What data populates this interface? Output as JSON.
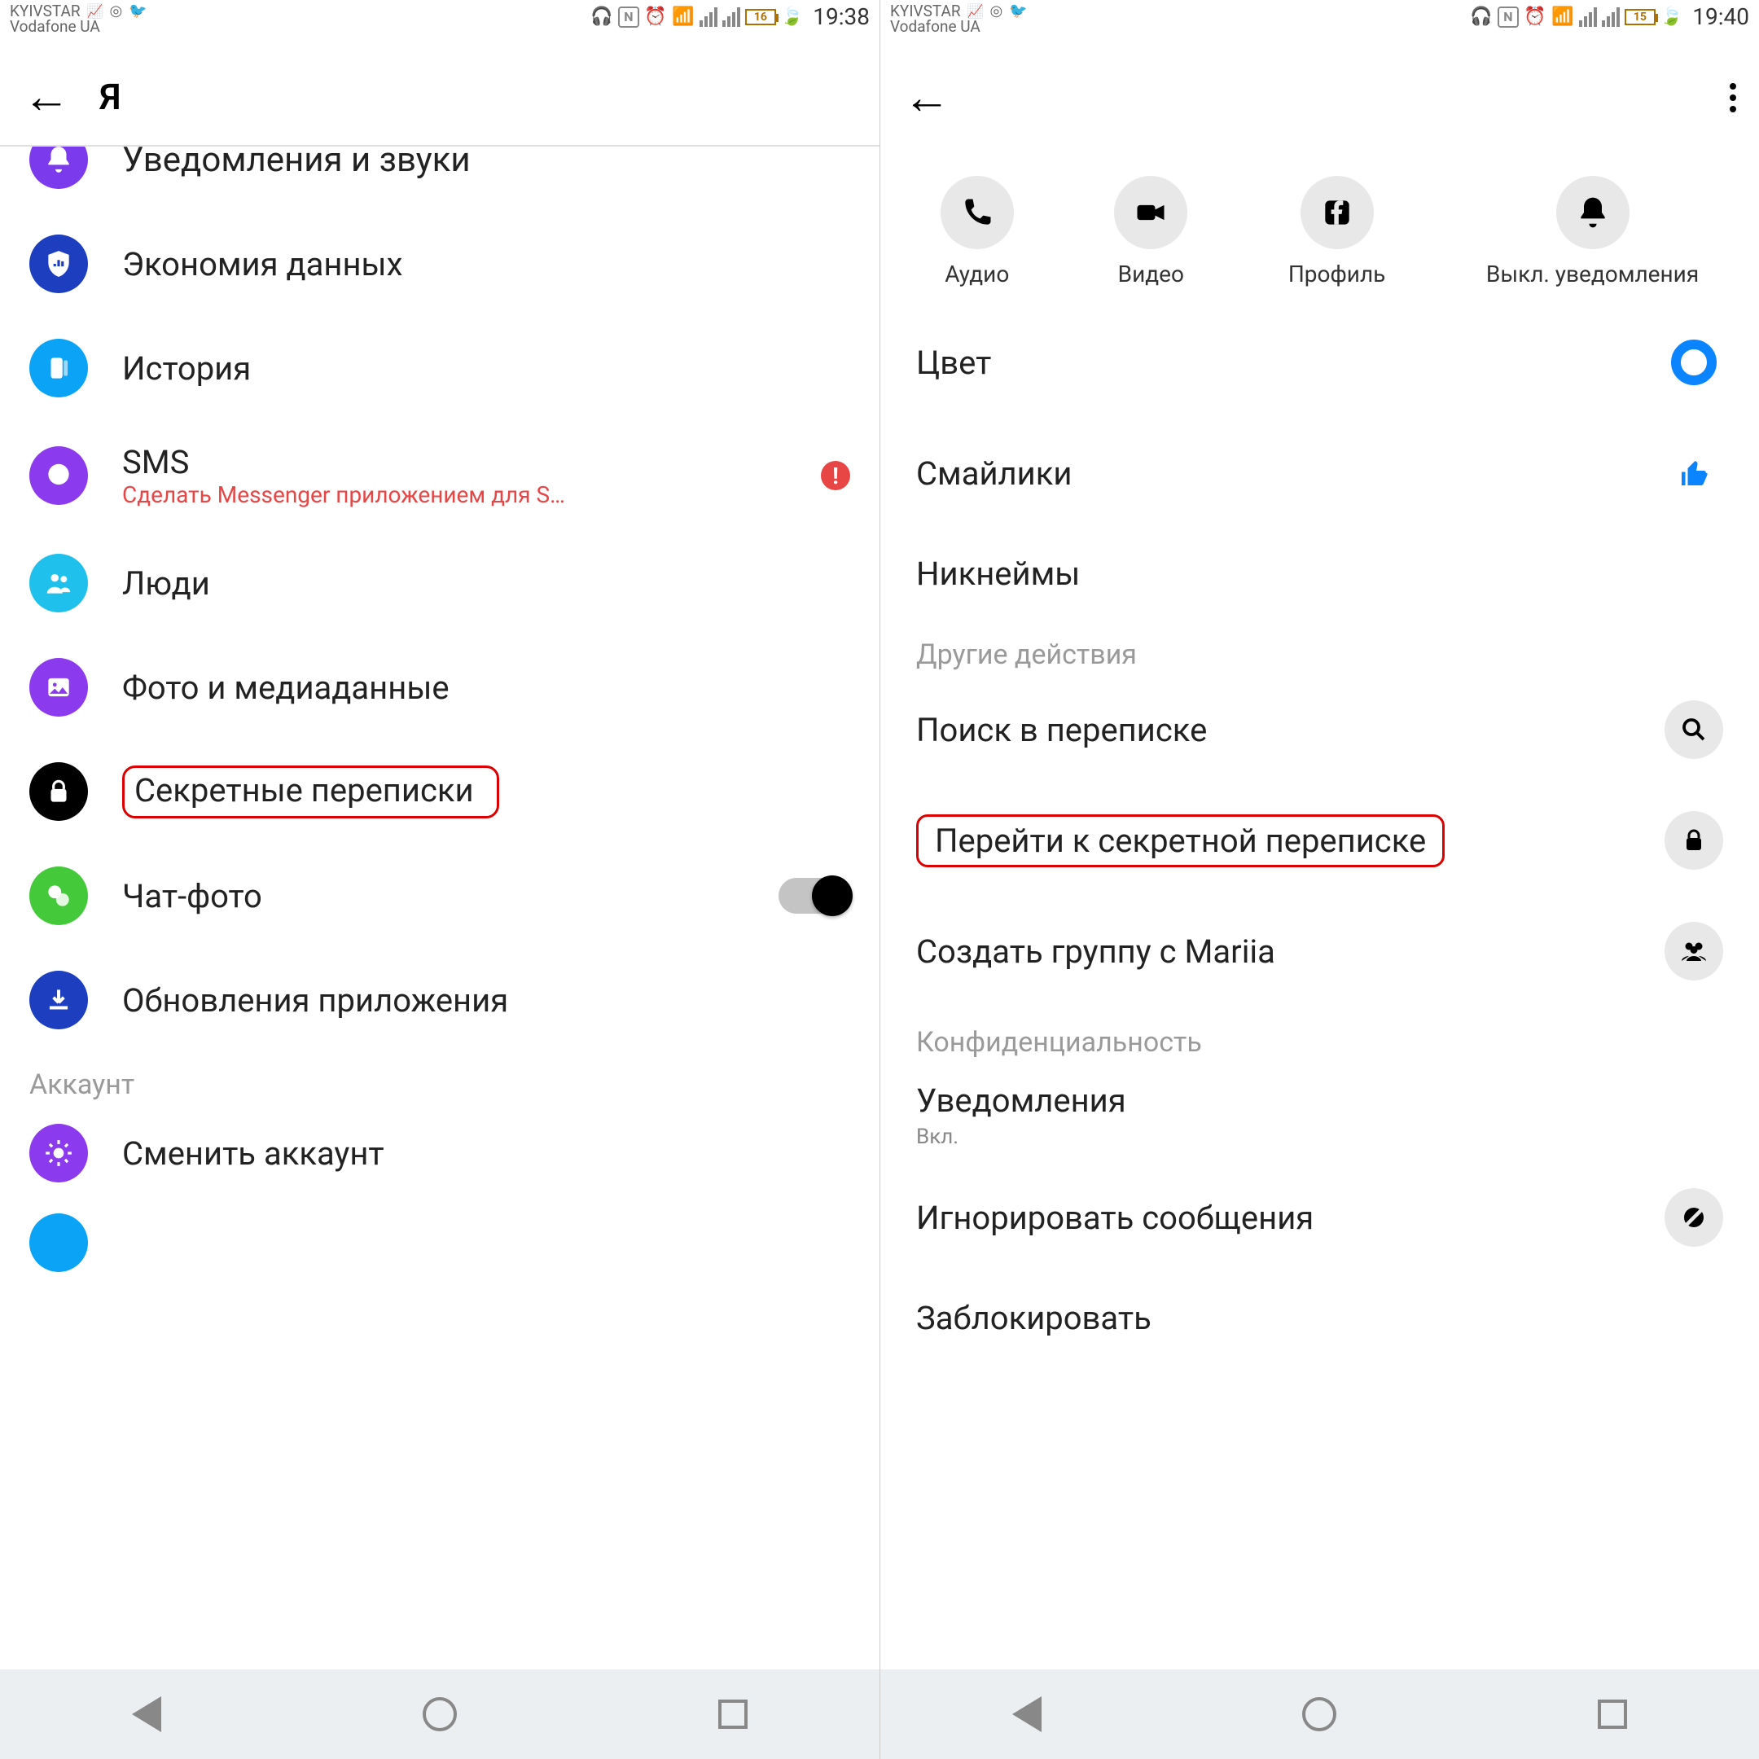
{
  "left": {
    "status": {
      "carrier1": "KYIVSTAR",
      "carrier2": "Vodafone UA",
      "battery": "16",
      "time": "19:38"
    },
    "header": {
      "title": "Я"
    },
    "items": {
      "notifications": "Уведомления и звуки",
      "datasaver": "Экономия данных",
      "story": "История",
      "sms": "SMS",
      "sms_sub": "Сделать Messenger приложением для S…",
      "people": "Люди",
      "photomedia": "Фото и медиаданные",
      "secret": "Секретные переписки",
      "chatphoto": "Чат-фото",
      "updates": "Обновления приложения",
      "section_account": "Аккаунт",
      "switch": "Сменить аккаунт"
    }
  },
  "right": {
    "status": {
      "carrier1": "KYIVSTAR",
      "carrier2": "Vodafone UA",
      "battery": "15",
      "time": "19:40"
    },
    "actions": {
      "audio": "Аудио",
      "video": "Видео",
      "profile": "Профиль",
      "mute": "Выкл. уведомления"
    },
    "items": {
      "color": "Цвет",
      "emoji": "Смайлики",
      "nicknames": "Никнеймы",
      "section_other": "Другие действия",
      "search": "Поиск в переписке",
      "secret": "Перейти к секретной переписке",
      "group": "Создать группу с Mariia",
      "section_privacy": "Конфиденциальность",
      "notif": "Уведомления",
      "notif_sub": "Вкл.",
      "ignore": "Игнорировать сообщения",
      "block": "Заблокировать"
    }
  }
}
